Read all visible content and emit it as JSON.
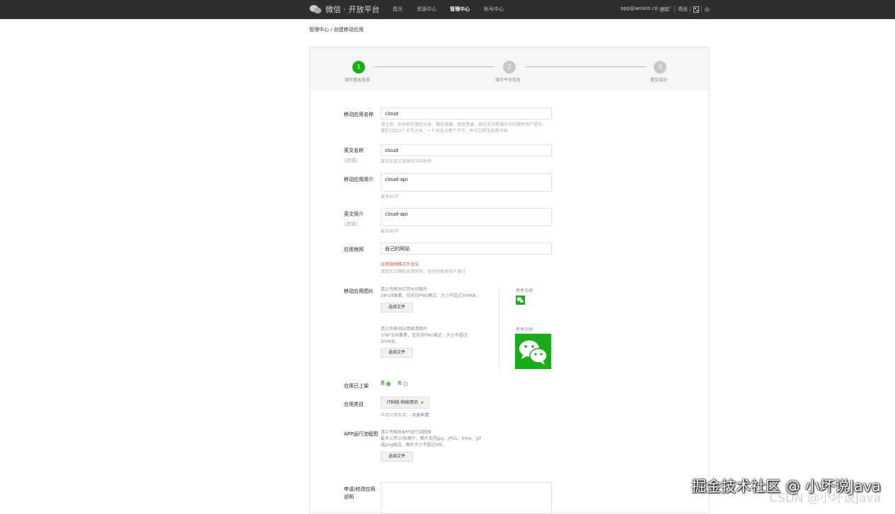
{
  "topbar": {
    "logo_text": "微信 · 开放平台",
    "nav": [
      "首页",
      "资源中心",
      "管理中心",
      "帐号中心"
    ],
    "account": "app@weixin.cn",
    "notice": "通知",
    "notice_badge": "6",
    "logout": "退出"
  },
  "breadcrumb": "管理中心 / 创建移动应用",
  "steps": [
    {
      "num": "1",
      "label": "填写基本信息"
    },
    {
      "num": "2",
      "label": "填写平台信息"
    },
    {
      "num": "3",
      "label": "提交成功"
    }
  ],
  "form": {
    "app_name": {
      "label": "移动应用名称",
      "value": "cloud",
      "hint1": "请注意，名称将在微信分享、微信收藏、微信登录、微信支付等操作中的跳转用户提示，",
      "hint2": "需在2到20个字节之间，一个中文占两个字节，并与已提交名称不同"
    },
    "en_name": {
      "label": "英文名称",
      "sub": "(选填)",
      "value": "cloud",
      "hint": "显示在英文版微信中的名称"
    },
    "app_intro": {
      "label": "移动应用简介",
      "value": "cloud-api",
      "hint": "最多80字"
    },
    "en_intro": {
      "label": "英文简介",
      "sub": "(选填)",
      "value": "cloud-api",
      "hint": "最多80字"
    },
    "website": {
      "label": "应用官网",
      "value": "自己的网站",
      "error": "应用官网格式不合法",
      "hint": "请填写正确的应用官网，否则可能审核不通过"
    },
    "images": {
      "label": "移动应用图片",
      "small_desc1": "请上传移动应用水印图片",
      "small_desc2": "28*28像素，仅支持PNG格式，大小不超过300KB。",
      "big_desc1": "请上传移动应用高清图片",
      "big_desc2": "108*108像素，仅支持PNG格式，大小不超过",
      "big_desc3": "300KB。",
      "button": "选择文件",
      "example": "参考示例"
    },
    "online": {
      "label": "应用已上架",
      "yes": "是",
      "no": "否"
    },
    "category": {
      "label": "应用类目",
      "value": "IT科技-科技资讯",
      "hint": "申请应用类目，",
      "link": "点击申请"
    },
    "flowchart": {
      "label": "APP运行流程图",
      "desc1": "请上传相关APP运行流程图",
      "desc2": "最多上传10张图片，图片支持jpg、JPEG、bmp、gif",
      "desc3": "或png格式，图片大小不超过5M。",
      "button": "选择文件"
    },
    "apply": {
      "label1": "申请/修改应用",
      "label2": "说明"
    }
  },
  "watermarks": {
    "main": "掘金技术社区 @ 小坏说Java",
    "csdn": "CSDN @小坏说Java"
  },
  "colors": {
    "topbar": "#2e2e2e",
    "active_step": "#1aad19",
    "wechat_green": "#1aad19",
    "error": "#e64340"
  }
}
